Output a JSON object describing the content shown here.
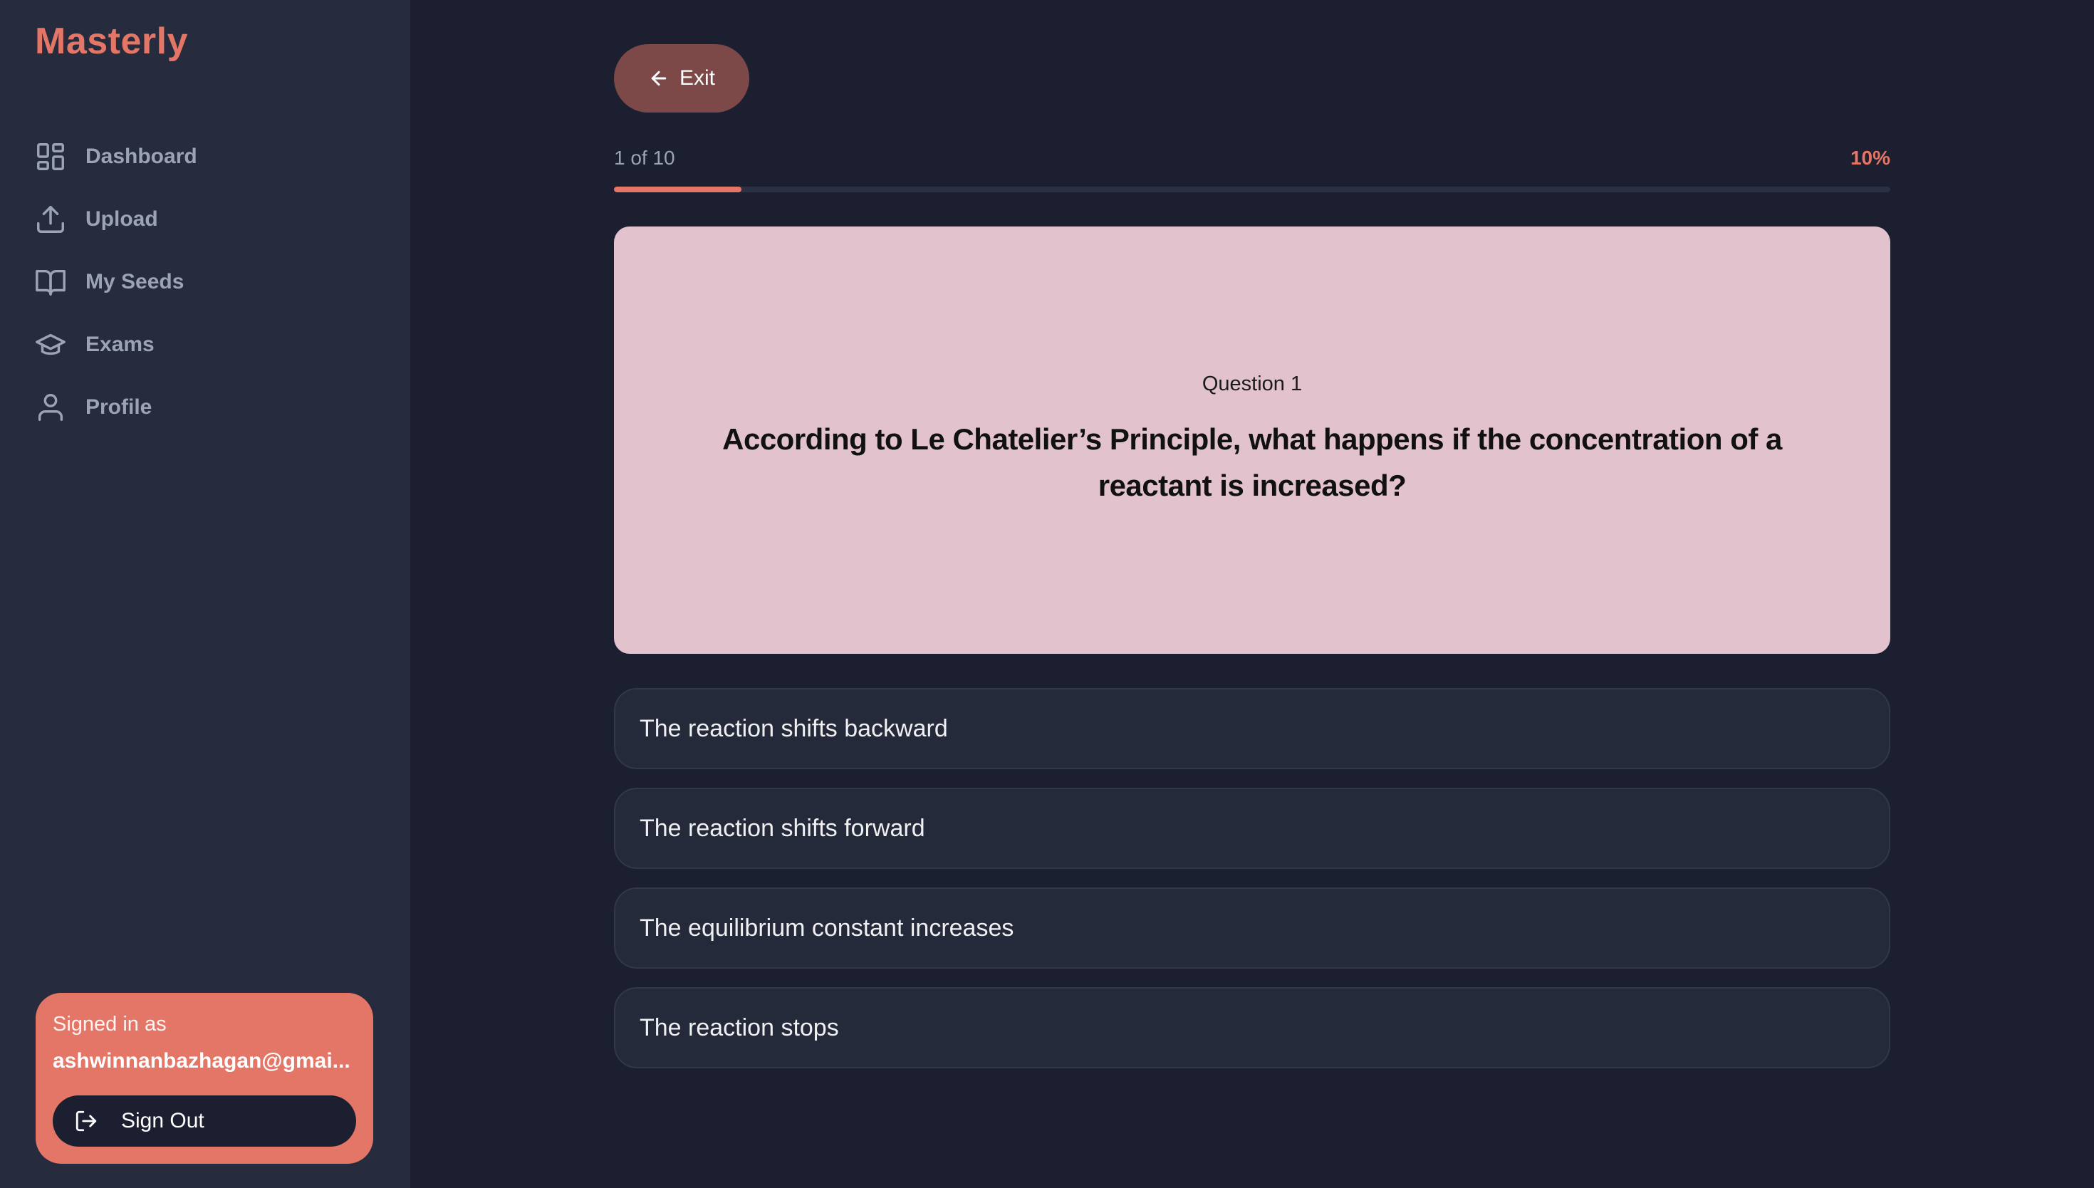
{
  "app": {
    "name": "Masterly"
  },
  "sidebar": {
    "items": [
      {
        "label": "Dashboard",
        "icon": "dashboard-icon"
      },
      {
        "label": "Upload",
        "icon": "upload-icon"
      },
      {
        "label": "My Seeds",
        "icon": "book-icon"
      },
      {
        "label": "Exams",
        "icon": "graduation-cap-icon"
      },
      {
        "label": "Profile",
        "icon": "user-icon"
      }
    ],
    "account": {
      "signed_in_label": "Signed in as",
      "email": "ashwinnanbazhagan@gmai...",
      "sign_out_label": "Sign Out"
    }
  },
  "quiz": {
    "exit_label": "Exit",
    "progress_text": "1 of 10",
    "progress_percent_label": "10%",
    "progress_fraction": 0.1,
    "question_number_label": "Question 1",
    "question_text": "According to Le Chatelier’s Principle, what happens if the concentration of a reactant is increased?",
    "options": [
      "The reaction shifts backward",
      "The reaction shifts forward",
      "The equilibrium constant increases",
      "The reaction stops"
    ]
  },
  "colors": {
    "background": "#1b1f2f",
    "sidebar": "#262c3d",
    "accent": "#e47667",
    "exit_button": "#7d4848",
    "question_card": "#e2c3cd",
    "option_background": "#252a3a"
  }
}
